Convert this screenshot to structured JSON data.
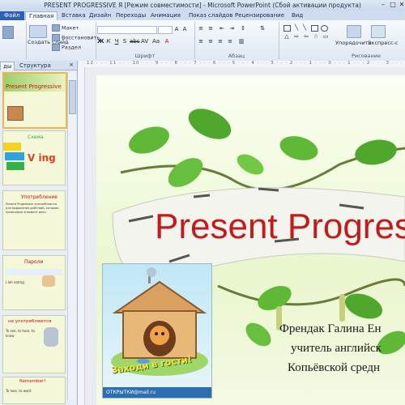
{
  "window": {
    "title": "PRESENT PROGRESSIVE Я [Режим совместимости] - Microsoft PowerPoint (Сбой активации продукта)"
  },
  "ribbon_tabs": {
    "file": "Файл",
    "items": [
      "Главная",
      "Вставка",
      "Дизайн",
      "Переходы",
      "Анимация",
      "Показ слайдов",
      "Рецензирование",
      "Вид"
    ]
  },
  "ribbon": {
    "create_slide": "Создать слайд",
    "layout": "Макет",
    "reset": "Восстановить",
    "section": "Раздел",
    "font_group": "Шрифт",
    "paragraph_group": "Абзац",
    "arrange": "Упорядочить",
    "quick_styles": "Экспресс-с",
    "drawing_group": "Рисование"
  },
  "panel": {
    "tab_slides": "ды",
    "tab_outline": "Структура",
    "close": "×"
  },
  "thumbnails": [
    {
      "num": "",
      "heading": "Present Progressive",
      "body": ""
    },
    {
      "num": "",
      "heading": "Схема",
      "body": "V ing"
    },
    {
      "num": "",
      "heading": "Употребление",
      "body": "Present Progressive употребляется для выражения действий, которые происходят в момент речи"
    },
    {
      "num": "",
      "heading": "Пароли",
      "body": "I am eating"
    },
    {
      "num": "",
      "heading": "не употребляются",
      "body": "To see, to hear, to know"
    },
    {
      "num": "",
      "heading": "Remember!",
      "body": "To love, to want"
    }
  ],
  "slide": {
    "title": "Present Progres",
    "author_lines": [
      "Френдак Галина Ен",
      "учитель английск",
      "Копьёвской средн"
    ],
    "card_text": "Заходи в гости!",
    "card_footer": "ОТКРЫТКИ@mail.ru"
  }
}
